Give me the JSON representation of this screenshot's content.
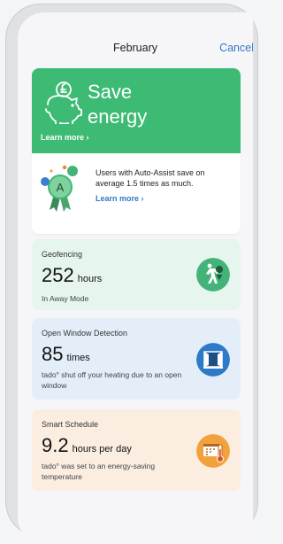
{
  "header": {
    "title": "February",
    "cancel_label": "Cancel"
  },
  "save_card": {
    "title_line1": "Save",
    "title_line2": "energy",
    "learn_more": "Learn more ›",
    "description": "Users with Auto-Assist save on average 1.5 times as much.",
    "learn_more_2": "Learn more ›",
    "medal_letter": "A"
  },
  "stats": [
    {
      "label": "Geofencing",
      "value": "252",
      "unit": "hours",
      "description": "In Away Mode"
    },
    {
      "label": "Open Window Detection",
      "value": "85",
      "unit": "times",
      "description": "tado° shut off your heating due to an open window"
    },
    {
      "label": "Smart Schedule",
      "value": "9.2",
      "unit": "hours per day",
      "description": "tado° was set to an energy-saving temperature"
    }
  ],
  "colors": {
    "green": "#3dbb74",
    "blue": "#2d7ac9",
    "orange": "#f2a23c",
    "teal": "#44b37a"
  }
}
